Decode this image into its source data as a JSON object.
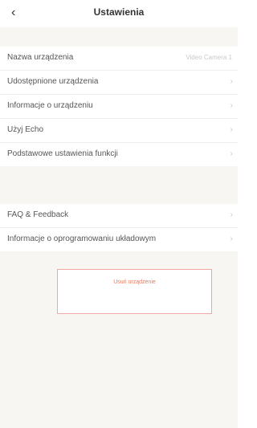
{
  "header": {
    "title": "Ustawienia",
    "back_icon": "chevron-left-icon"
  },
  "section1": {
    "rows": [
      {
        "label": "Nazwa urządzenia",
        "value": "Video Camera 1"
      },
      {
        "label": "Udostępnione urządzenia",
        "value": "›"
      },
      {
        "label": "Informacje o urządzeniu",
        "value": "›"
      },
      {
        "label": "Użyj Echo",
        "value": "›"
      },
      {
        "label": "Podstawowe ustawienia funkcji",
        "value": "›"
      }
    ]
  },
  "section2": {
    "rows": [
      {
        "label": "FAQ & Feedback",
        "value": "›"
      },
      {
        "label": "Informacje o oprogramowaniu układowym",
        "value": "›"
      }
    ]
  },
  "remove_button": {
    "label": "Usuń urządzenie"
  },
  "colors": {
    "accent": "#e27d5f",
    "remove_border": "#f0a7a1",
    "background": "#f8f6f3"
  }
}
